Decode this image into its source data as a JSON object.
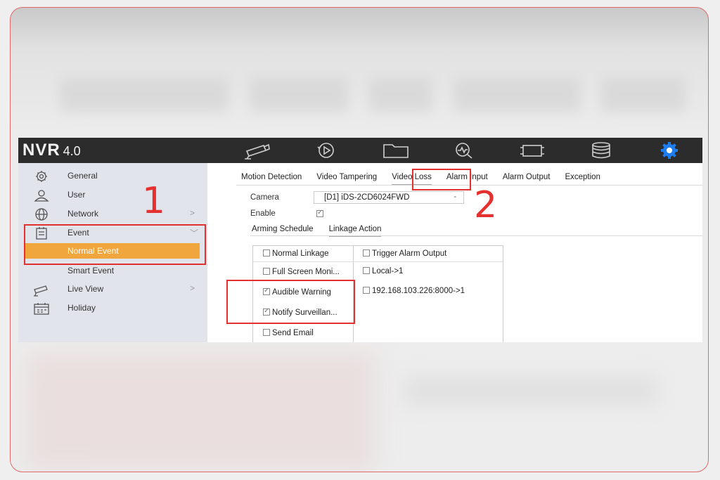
{
  "app": {
    "logo": "NVR",
    "version": "4.0"
  },
  "topbar_icons": [
    "camera-icon",
    "playback-icon",
    "folder-icon",
    "search-icon",
    "record-camera-icon",
    "storage-icon",
    "settings-gear-icon"
  ],
  "sidebar": {
    "items": [
      {
        "label": "General",
        "icon": "gear-icon"
      },
      {
        "label": "User",
        "icon": "user-icon"
      },
      {
        "label": "Network",
        "icon": "globe-icon",
        "chevron": ">"
      },
      {
        "label": "Event",
        "icon": "event-icon",
        "chevron": "﹀"
      },
      {
        "label": "Normal Event"
      },
      {
        "label": "Smart Event"
      },
      {
        "label": "Live View",
        "icon": "camera-icon",
        "chevron": ">"
      },
      {
        "label": "Holiday",
        "icon": "calendar-icon"
      }
    ]
  },
  "tabs": [
    "Motion Detection",
    "Video Tampering",
    "Video Loss",
    "Alarm Input",
    "Alarm Output",
    "Exception"
  ],
  "form": {
    "camera_label": "Camera",
    "camera_value": "[D1]  iDS-2CD6024FWD",
    "camera_dropdown": "-",
    "enable_label": "Enable",
    "enable_checked": true
  },
  "subtabs": [
    "Arming Schedule",
    "Linkage Action"
  ],
  "linkage": {
    "left": [
      {
        "label": "Normal Linkage",
        "checked": false
      },
      {
        "label": "Full Screen Moni...",
        "checked": false
      },
      {
        "label": "Audible Warning",
        "checked": true
      },
      {
        "label": "Notify Surveillan...",
        "checked": true
      },
      {
        "label": "Send Email",
        "checked": false
      }
    ],
    "right": [
      {
        "label": "Trigger Alarm Output",
        "checked": false
      },
      {
        "label": "Local->1",
        "checked": false
      },
      {
        "label": "192.168.103.226:8000->1",
        "checked": false
      }
    ]
  },
  "annotations": {
    "one": "1",
    "two": "2"
  },
  "colors": {
    "topbar": "#2c2c2c",
    "sidebar": "#e2e4ec",
    "highlight": "#f0a63c",
    "annotation": "#e53030",
    "gear": "#1e7ef0"
  }
}
